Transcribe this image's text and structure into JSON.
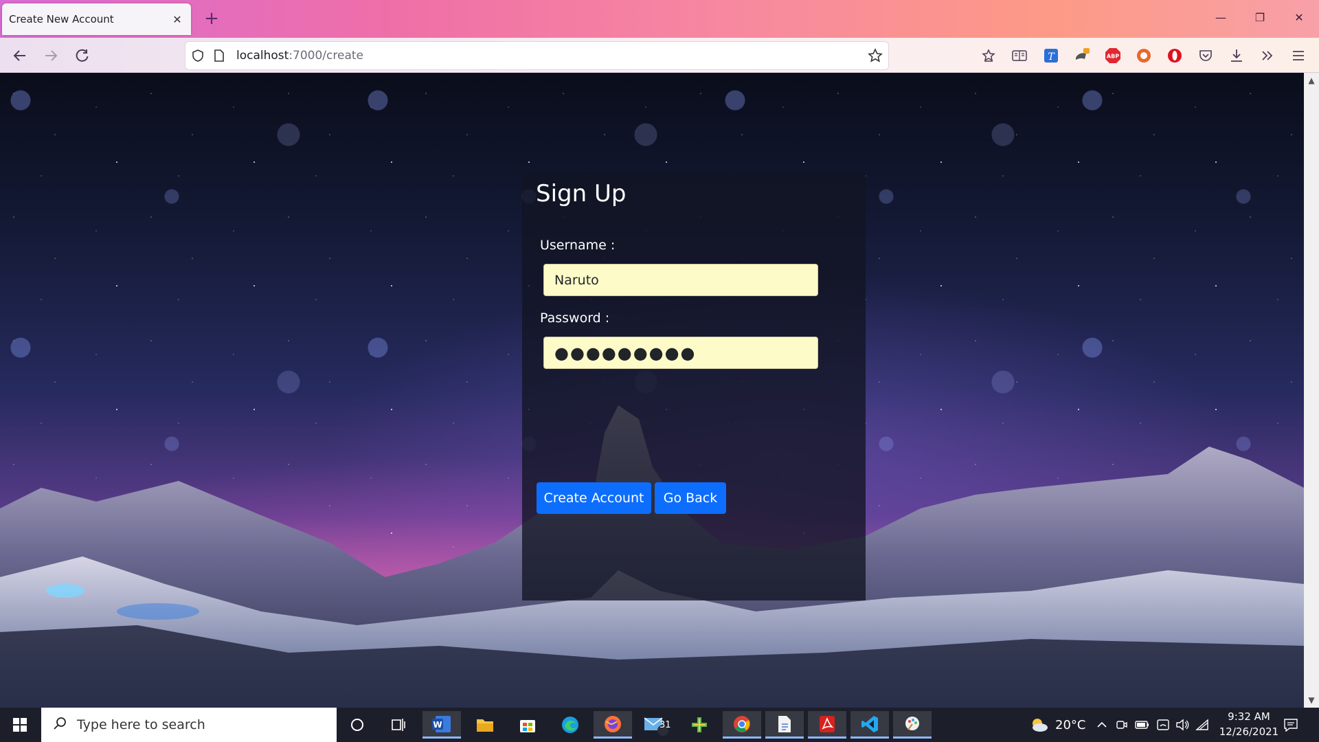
{
  "browser": {
    "tab_title": "Create New Account",
    "tab_close": "✕",
    "new_tab": "+",
    "url_host": "localhost",
    "url_path": ":7000/create",
    "minimize": "—",
    "restore": "❐",
    "close": "✕"
  },
  "page": {
    "title": "Sign Up",
    "username_label": "Username :",
    "username_value": "Naruto",
    "password_label": "Password :",
    "password_value": "●●●●●●●●●",
    "create_button": "Create Account",
    "back_button": "Go Back"
  },
  "taskbar": {
    "search_placeholder": "Type here to search",
    "mail_badge": "31",
    "temperature": "20°C",
    "time": "9:32 AM",
    "date": "12/26/2021"
  },
  "colors": {
    "primary_button": "#0d6efd",
    "input_fill": "#fdfbc8",
    "card_background": "rgba(18,20,34,.78)"
  }
}
